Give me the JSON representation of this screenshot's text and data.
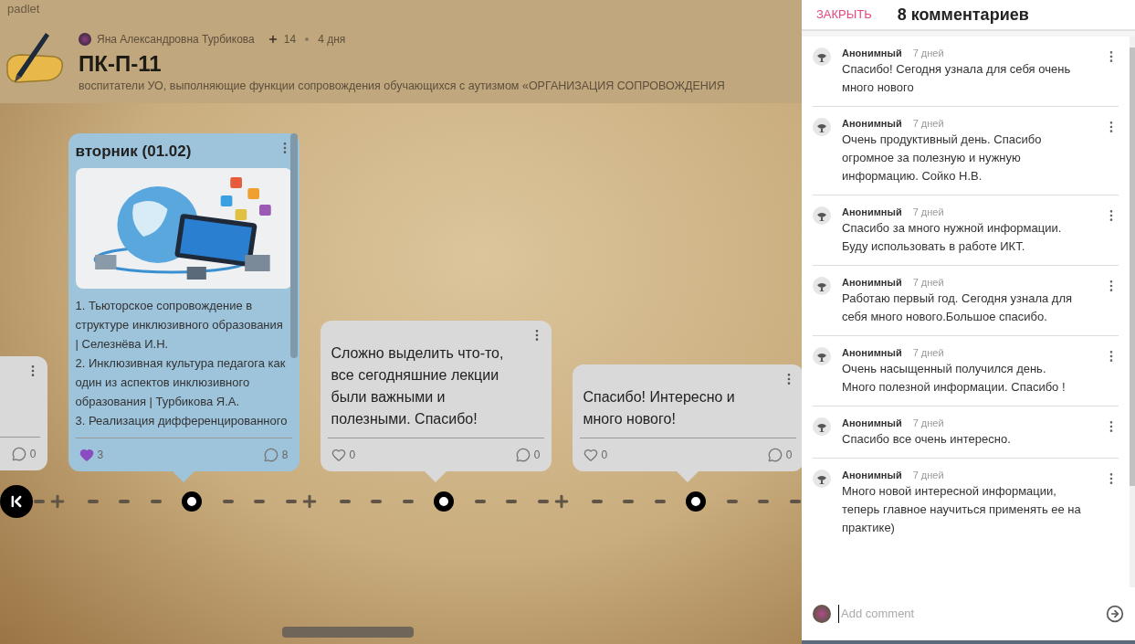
{
  "app": {
    "name": "padlet"
  },
  "board": {
    "author": "Яна Александровна Турбикова",
    "likes": "14",
    "age": "4 дня",
    "title": "ПК-П-11",
    "description": "воспитатели УО, выполняющие функции сопровождения обучающихся с аутизмом «ОРГАНИЗАЦИЯ СОПРОВОЖДЕНИЯ"
  },
  "posts": [
    {
      "color": "#d9d9d9",
      "comments": "0"
    },
    {
      "color": "#9ec4dc",
      "title": "вторник (01.02)",
      "body": " 1. Тьюторское сопровождение в структуре инклюзивного образования | Селезнёва И.Н.\n 2. Инклюзивная культура педагога как один из аспектов инклюзивного образования | Турбикова Я.А.\n 3.  Реализация дифференцированного",
      "liked": true,
      "likes": "3",
      "comments": "8"
    },
    {
      "color": "#d9d9d9",
      "body": "Сложно выделить что-то, все сегодняшние лекции были важными и полезными. Спасибо!",
      "liked": false,
      "likes": "0",
      "comments": "0"
    },
    {
      "color": "#d9d9d9",
      "body": "Спасибо! Интересно и много нового!",
      "liked": false,
      "likes": "0",
      "comments": "0"
    }
  ],
  "comments_panel": {
    "close": "ЗАКРЫТЬ",
    "title": "8 комментариев",
    "placeholder": "Add comment",
    "comments": [
      {
        "author": "Анонимный",
        "time": "7 дней",
        "text": "Спасибо! Сегодня узнала для себя очень много нового"
      },
      {
        "author": "Анонимный",
        "time": "7 дней",
        "text": "Очень продуктивный день. Спасибо огромное за полезную и нужную информацию. Сойко Н.В."
      },
      {
        "author": "Анонимный",
        "time": "7 дней",
        "text": "Спасибо за много нужной информации. Буду использовать в работе ИКТ."
      },
      {
        "author": "Анонимный",
        "time": "7 дней",
        "text": "Работаю первый год. Сегодня узнала для себя много нового.Большое спасибо."
      },
      {
        "author": "Анонимный",
        "time": "7 дней",
        "text": "Очень насыщенный получился день. Много полезной информации. Спасибо !"
      },
      {
        "author": "Анонимный",
        "time": "7 дней",
        "text": "Спасибо все очень интересно."
      },
      {
        "author": "Анонимный",
        "time": "7 дней",
        "text": "Много новой интересной информации, теперь главное научиться применять ее на практике)"
      }
    ]
  }
}
